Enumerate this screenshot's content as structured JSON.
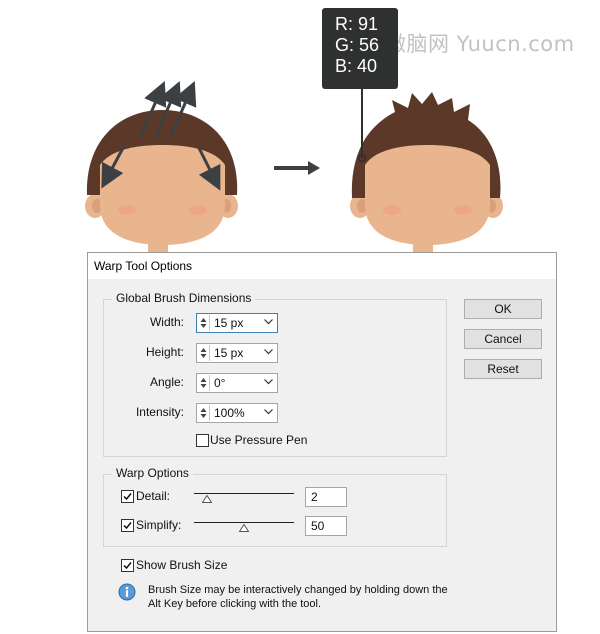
{
  "watermark": "微脑网 Yuucn.com",
  "color_tooltip": {
    "r_label": "R: 91",
    "g_label": "G: 56",
    "b_label": "B: 40",
    "swatch_color": "#5b3828"
  },
  "illustration": {
    "hair_color": "#5b3828",
    "skin_color": "#e8b58e",
    "cheek_color": "#eda68a",
    "ear_inner_color": "#d9a07c",
    "arrow_color": "#3d4043"
  },
  "dialog": {
    "title": "Warp Tool Options",
    "global_brush": {
      "title": "Global Brush Dimensions",
      "width": {
        "label": "Width:",
        "value": "15 px"
      },
      "height": {
        "label": "Height:",
        "value": "15 px"
      },
      "angle": {
        "label": "Angle:",
        "value": "0°"
      },
      "intensity": {
        "label": "Intensity:",
        "value": "100%"
      },
      "use_pressure_pen": {
        "label": "Use Pressure Pen",
        "checked": false
      }
    },
    "warp_options": {
      "title": "Warp Options",
      "detail": {
        "label": "Detail:",
        "checked": true,
        "value": "2"
      },
      "simplify": {
        "label": "Simplify:",
        "checked": true,
        "value": "50"
      }
    },
    "show_brush_size": {
      "label": "Show Brush Size",
      "checked": true
    },
    "info_text": "Brush Size may be interactively changed by holding down the Alt Key before clicking with the tool.",
    "buttons": {
      "ok": "OK",
      "cancel": "Cancel",
      "reset": "Reset"
    }
  }
}
